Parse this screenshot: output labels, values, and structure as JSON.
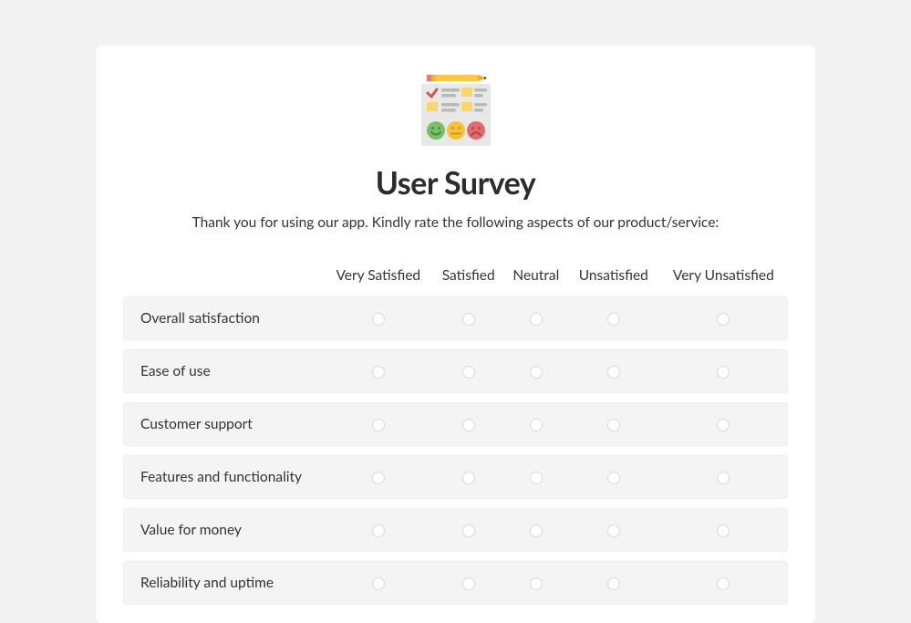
{
  "title": "User Survey",
  "subtitle": "Thank you for using our app. Kindly rate the following aspects of our product/service:",
  "scale": [
    "Very Satisfied",
    "Satisfied",
    "Neutral",
    "Unsatisfied",
    "Very Unsatisfied"
  ],
  "rows": [
    {
      "label": "Overall satisfaction"
    },
    {
      "label": "Ease of use"
    },
    {
      "label": "Customer support"
    },
    {
      "label": "Features and functionality"
    },
    {
      "label": "Value for money"
    },
    {
      "label": "Reliability and uptime"
    }
  ]
}
